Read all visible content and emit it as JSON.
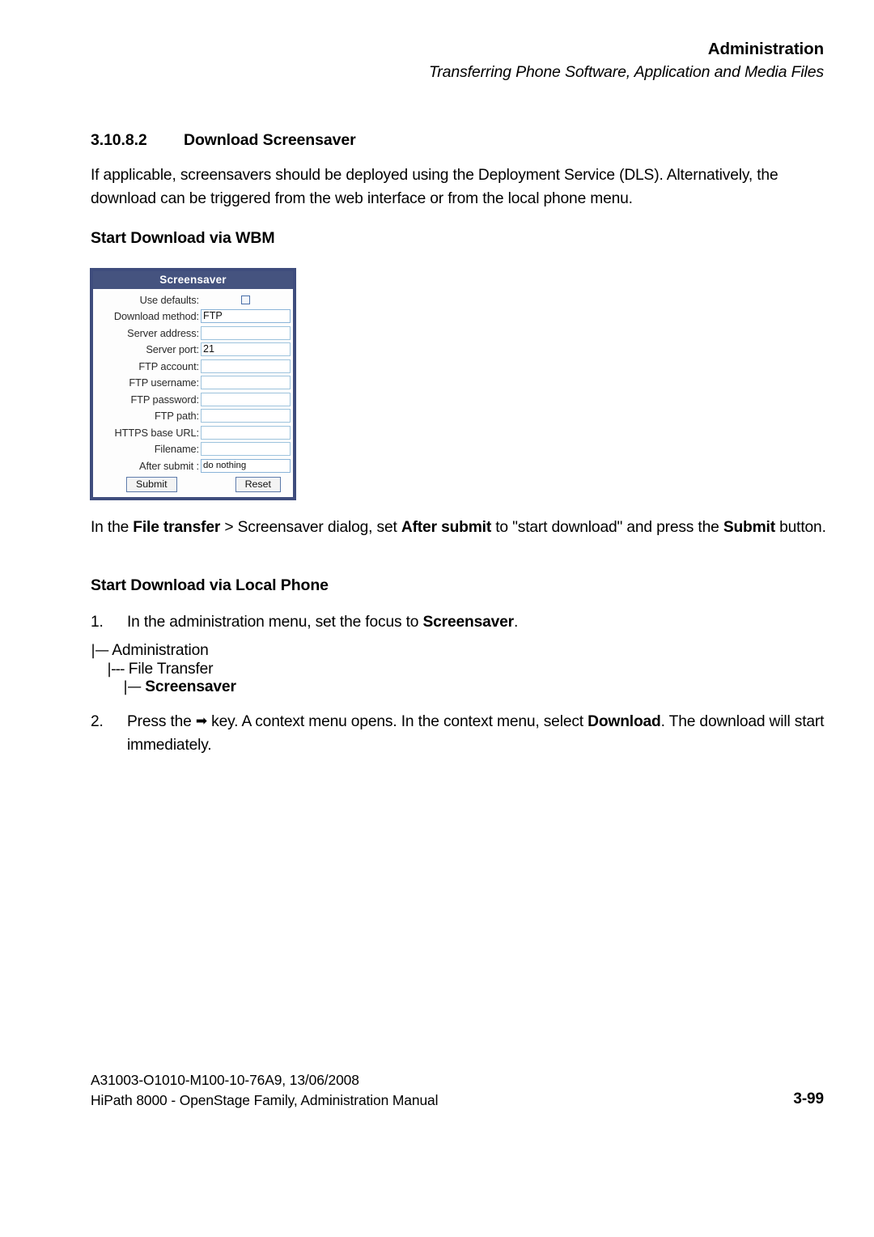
{
  "runhead": {
    "title": "Administration",
    "subtitle": "Transferring Phone Software, Application and Media Files"
  },
  "section": {
    "number": "3.10.8.2",
    "title": "Download Screensaver"
  },
  "intro_paragraph": {
    "text": "If applicable, screensavers should be deployed using the Deployment Service (DLS). Alternatively, the download can be triggered from the web interface or from the local phone menu."
  },
  "subheadings": {
    "wbm": "Start Download via WBM",
    "local_phone": "Start Download via Local Phone"
  },
  "wbm_dialog": {
    "title": "Screensaver",
    "rows": [
      {
        "label": "Use defaults:",
        "type": "checkbox",
        "value": ""
      },
      {
        "label": "Download method:",
        "type": "select",
        "value": "FTP"
      },
      {
        "label": "Server address:",
        "type": "text",
        "value": ""
      },
      {
        "label": "Server port:",
        "type": "text",
        "value": "21"
      },
      {
        "label": "FTP account:",
        "type": "text",
        "value": ""
      },
      {
        "label": "FTP username:",
        "type": "text",
        "value": ""
      },
      {
        "label": "FTP password:",
        "type": "text",
        "value": ""
      },
      {
        "label": "FTP path:",
        "type": "text",
        "value": ""
      },
      {
        "label": "HTTPS base URL:",
        "type": "text",
        "value": ""
      },
      {
        "label": "Filename:",
        "type": "text",
        "value": ""
      },
      {
        "label": "After submit :",
        "type": "select-small",
        "value": "do nothing"
      }
    ],
    "submit_label": "Submit",
    "reset_label": "Reset",
    "colors": {
      "frame": "#3f4d7d",
      "titlebar": "#45537f",
      "field_border": "#9dc3dd",
      "caret_button": "#cfe0f5"
    }
  },
  "wbm_paragraph": {
    "part1": "In the ",
    "bold1": "File transfer",
    "part2": " > Screensaver dialog, set ",
    "bold2": "After submit",
    "part3": " to \"start download\" and press the ",
    "bold3": "Submit",
    "part4": " button."
  },
  "steps": [
    {
      "number": "1.",
      "part1": "In the administration menu, set the focus to ",
      "bold1": "Screensaver",
      "part2": "."
    },
    {
      "number": "2.",
      "part1": "Press the ",
      "icon": "➡",
      "part2": " key. A context menu opens. In the context menu, select ",
      "bold1": "Download",
      "part3": ". The download will start immediately."
    }
  ],
  "menu_tree": {
    "connector_l1": "|—",
    "connector_l2": "|---",
    "connector_l3": "|—",
    "levels": [
      {
        "label": "Administration",
        "bold": false
      },
      {
        "label": "File Transfer",
        "bold": false
      },
      {
        "label": "Screensaver",
        "bold": true
      }
    ]
  },
  "footer": {
    "line1": "A31003-O1010-M100-10-76A9, 13/06/2008",
    "line2": "HiPath 8000 - OpenStage Family, Administration Manual",
    "page": "3-99"
  }
}
